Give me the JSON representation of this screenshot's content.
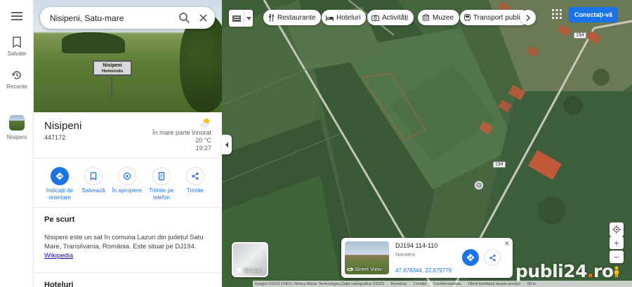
{
  "rail": {
    "saved_label": "Salvate",
    "recent_label": "Recente",
    "place_label": "Nisipeni"
  },
  "search": {
    "value": "Nisipeni, Satu-mare"
  },
  "hero": {
    "sign_text_1": "Nisipeni",
    "sign_text_2": "Homorodu"
  },
  "place": {
    "title": "Nisipeni",
    "code": "447172"
  },
  "weather": {
    "condition": "În mare parte înnorat",
    "temperature": "20 °C",
    "time": "19:27"
  },
  "actions": [
    {
      "label": "Indicații de orientare",
      "icon": "directions-icon"
    },
    {
      "label": "Salvează",
      "icon": "bookmark-icon"
    },
    {
      "label": "În apropiere",
      "icon": "nearby-icon"
    },
    {
      "label": "Trimite pe telefon",
      "icon": "phone-icon"
    },
    {
      "label": "Trimite",
      "icon": "share-icon"
    }
  ],
  "summary": {
    "title": "Pe scurt",
    "text": "Nisipeni este un sat în comuna Lazuri din județul Satu Mare, Transilvania, România. Este situat pe DJ194.",
    "link": "Wikipedia"
  },
  "hotels_title": "Hoteluri",
  "chips": [
    {
      "label": "Restaurante",
      "icon": "fork-knife-icon"
    },
    {
      "label": "Hoteluri",
      "icon": "bed-icon"
    },
    {
      "label": "Activități",
      "icon": "camera-icon"
    },
    {
      "label": "Muzee",
      "icon": "museum-icon"
    },
    {
      "label": "Transport public",
      "icon": "transit-icon"
    }
  ],
  "signin_label": "Conectați-vă",
  "road_labels": [
    "194",
    "194"
  ],
  "layers_label": "Straturi",
  "streetview": {
    "title": "DJ194 114-110",
    "subtitle": "Noroieni",
    "coords": "47.878344, 22.879779",
    "thumb_label": "Street View"
  },
  "zoom": {
    "in": "+",
    "out": "−"
  },
  "footer": {
    "imagery": "Imagini ©2023 CNES / Airbus,Maxar Technologies,Date cartografice ©2023",
    "country": "România",
    "terms": "Condiții",
    "privacy": "Confidențialitate",
    "feedback": "Oferă feedback despre produs",
    "scale": "50 m"
  },
  "watermark": {
    "text": "publi24",
    "dot": ".",
    "tld": "ro"
  },
  "colors": {
    "accent": "#1a73e8",
    "watermark_dot": "#ff6a00"
  }
}
